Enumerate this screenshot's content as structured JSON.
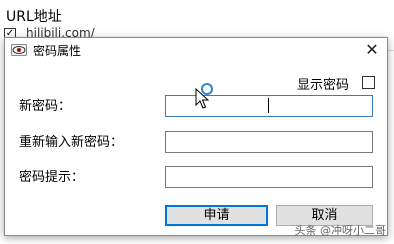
{
  "background": {
    "label": "URL地址",
    "link_text": "hilibili.com/",
    "checkbox_mark": "✓"
  },
  "dialog": {
    "title": "密码属性",
    "close_glyph": "✕",
    "show_password_label": "显示密码",
    "show_password_checked": false,
    "fields": {
      "new_password_label": "新密码：",
      "new_password_value": "",
      "confirm_password_label": "重新输入新密码：",
      "confirm_password_value": "",
      "hint_label": "密码提示：",
      "hint_value": ""
    },
    "buttons": {
      "apply": "申请",
      "cancel": "取消"
    }
  },
  "watermark": "头条 @冲呀小二哥",
  "colors": {
    "accent": "#0078d7",
    "field_focus": "#3c7fb1"
  }
}
